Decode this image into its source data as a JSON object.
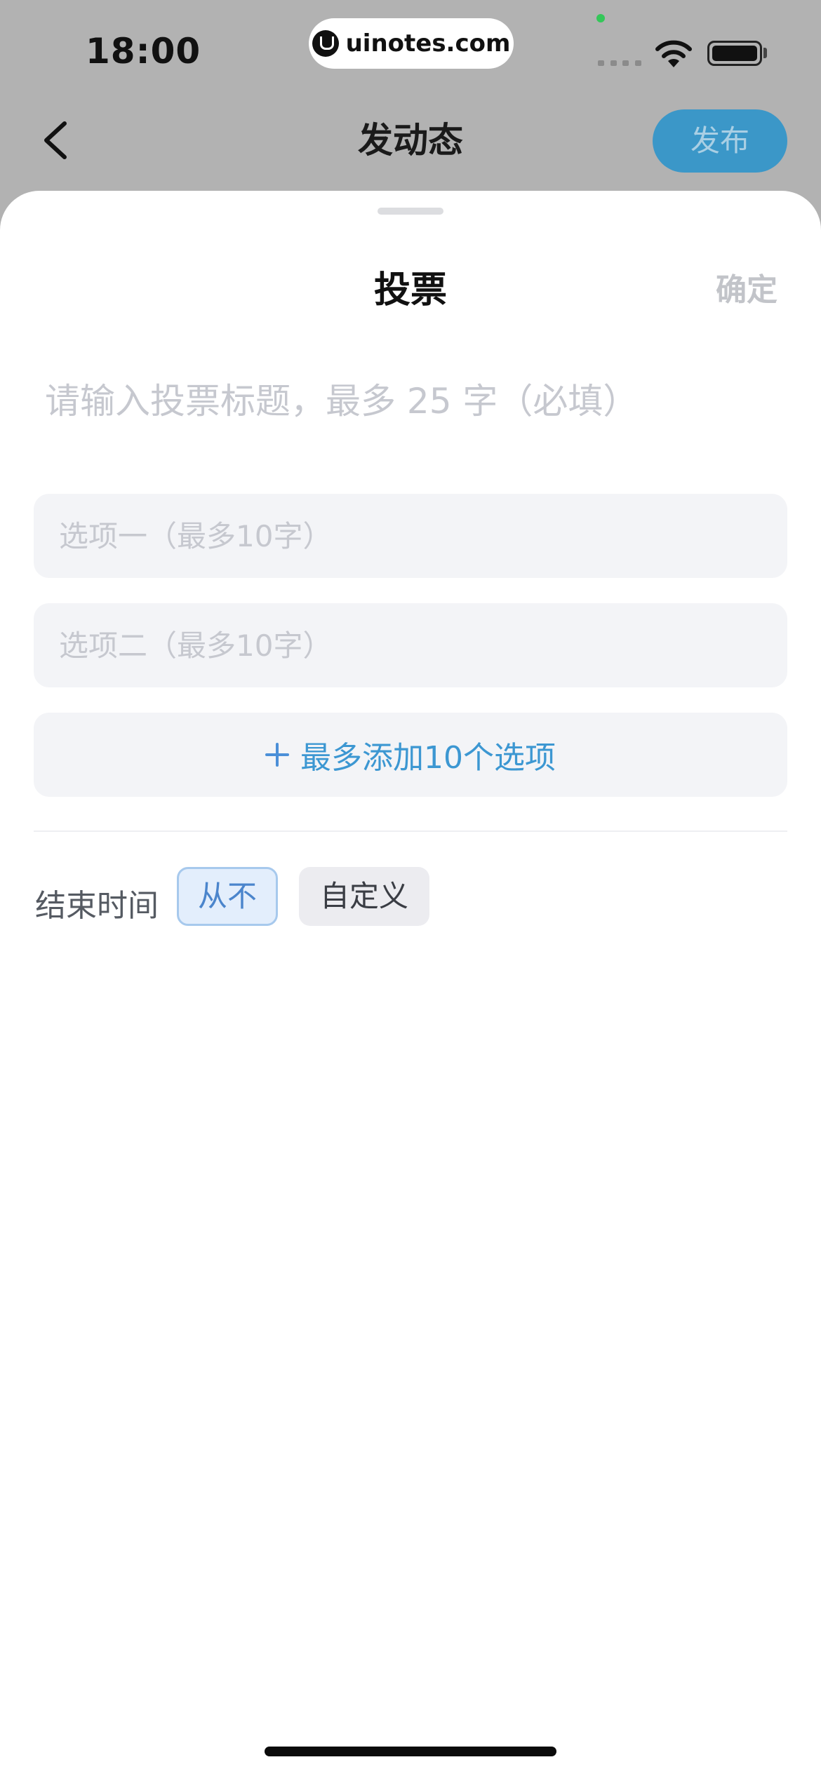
{
  "status_bar": {
    "time": "18:00",
    "url": "uinotes.com"
  },
  "header": {
    "title": "发动态",
    "publish_label": "发布"
  },
  "sheet": {
    "title": "投票",
    "confirm_label": "确定",
    "poll_title_placeholder": "请输入投票标题，最多 25 字（必填）",
    "options": [
      {
        "placeholder": "选项一（最多10字）",
        "value": ""
      },
      {
        "placeholder": "选项二（最多10字）",
        "value": ""
      }
    ],
    "add_option_label": "最多添加10个选项",
    "end_time": {
      "label": "结束时间",
      "choices": [
        {
          "label": "从不",
          "selected": true
        },
        {
          "label": "自定义",
          "selected": false
        }
      ]
    }
  },
  "colors": {
    "accent": "#3c97d2",
    "publish_button": "#3b97c8",
    "selected_chip_bg": "#e3eefc",
    "selected_chip_border": "#a7c9ed",
    "field_bg": "#f3f4f7",
    "placeholder": "#c6c8cf"
  }
}
